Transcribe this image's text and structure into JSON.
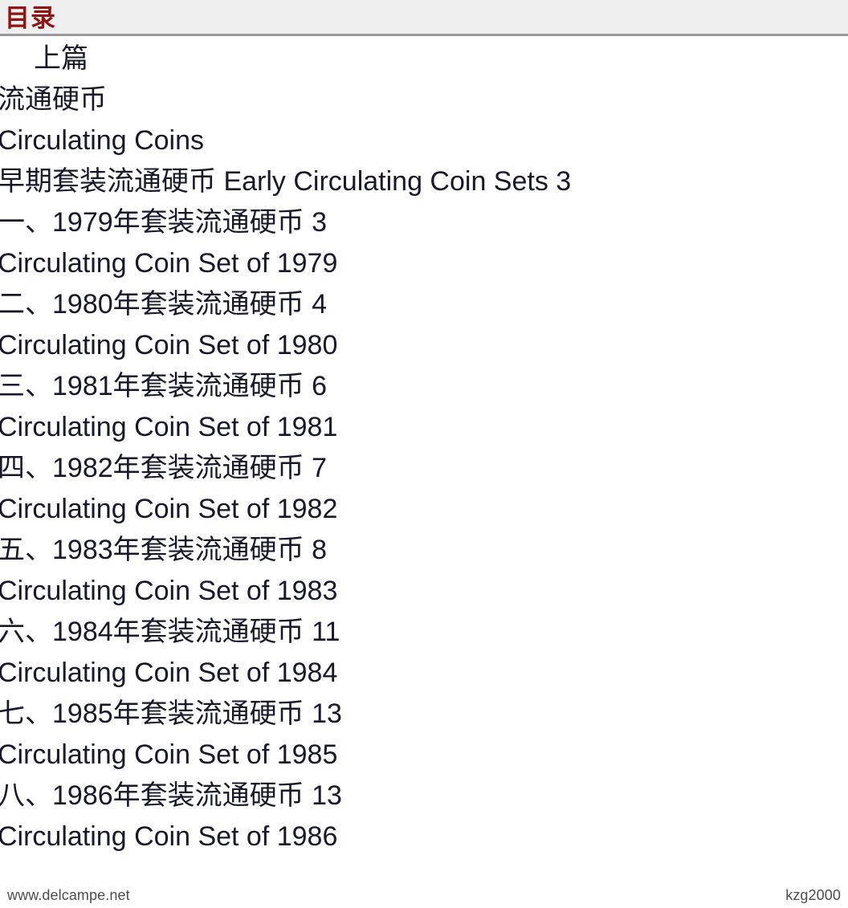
{
  "header": {
    "title": "目录",
    "bg_color": "#efefef",
    "title_color": "#8f1515",
    "border_color": "#9a9a9a"
  },
  "toc": {
    "lines": [
      {
        "text": "上篇",
        "indent": true
      },
      {
        "text": "流通硬币",
        "indent": false
      },
      {
        "text": "Circulating Coins",
        "indent": false
      },
      {
        "text": "早期套装流通硬币 Early Circulating Coin Sets 3",
        "indent": false
      },
      {
        "text": "一、1979年套装流通硬币 3",
        "indent": false
      },
      {
        "text": "Circulating Coin Set of 1979",
        "indent": false
      },
      {
        "text": "二、1980年套装流通硬币 4",
        "indent": false
      },
      {
        "text": "Circulating Coin Set of 1980",
        "indent": false
      },
      {
        "text": "三、1981年套装流通硬币 6",
        "indent": false
      },
      {
        "text": "Circulating Coin Set of 1981",
        "indent": false
      },
      {
        "text": "四、1982年套装流通硬币 7",
        "indent": false
      },
      {
        "text": "Circulating Coin Set of 1982",
        "indent": false
      },
      {
        "text": "五、1983年套装流通硬币 8",
        "indent": false
      },
      {
        "text": "Circulating Coin Set of 1983",
        "indent": false
      },
      {
        "text": "六、1984年套装流通硬币 11",
        "indent": false
      },
      {
        "text": "Circulating Coin Set of 1984",
        "indent": false
      },
      {
        "text": "七、1985年套装流通硬币 13",
        "indent": false
      },
      {
        "text": "Circulating Coin Set of 1985",
        "indent": false
      },
      {
        "text": "八、1986年套装流通硬币 13",
        "indent": false
      },
      {
        "text": "Circulating Coin Set of 1986",
        "indent": false
      }
    ]
  },
  "watermarks": {
    "left": "www.delcampe.net",
    "right": "kzg2000",
    "color": "#4d4d4d"
  }
}
